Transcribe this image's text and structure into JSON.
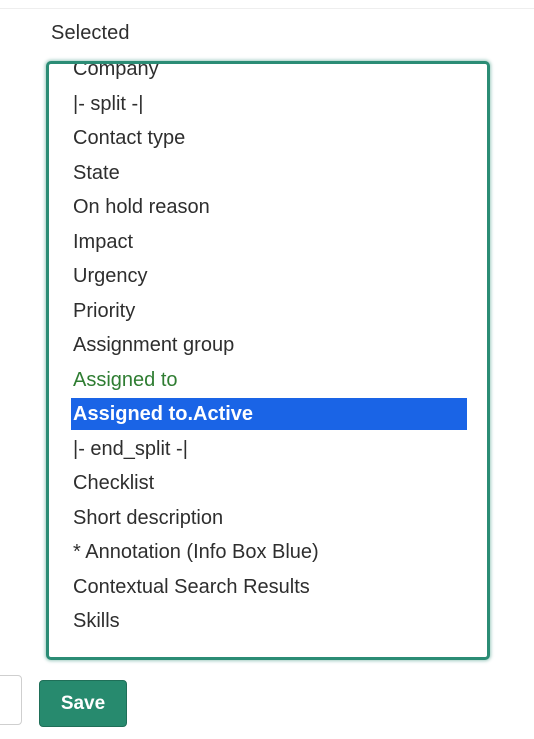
{
  "label": "Selected",
  "options": [
    {
      "text": "Company"
    },
    {
      "text": "|- split -|"
    },
    {
      "text": "Contact type"
    },
    {
      "text": "State"
    },
    {
      "text": "On hold reason"
    },
    {
      "text": "Impact"
    },
    {
      "text": "Urgency"
    },
    {
      "text": "Priority"
    },
    {
      "text": "Assignment group"
    },
    {
      "text": "Assigned to",
      "style": "green"
    },
    {
      "text": "Assigned to.Active",
      "style": "selected"
    },
    {
      "text": "|- end_split -|"
    },
    {
      "text": "Checklist"
    },
    {
      "text": "Short description"
    },
    {
      "text": "* Annotation (Info Box Blue)"
    },
    {
      "text": "Contextual Search Results"
    },
    {
      "text": "Skills"
    }
  ],
  "save_label": "Save",
  "colors": {
    "accent": "#278a6e",
    "selection": "#1a64e6",
    "highlight_text": "#2f7d32"
  }
}
